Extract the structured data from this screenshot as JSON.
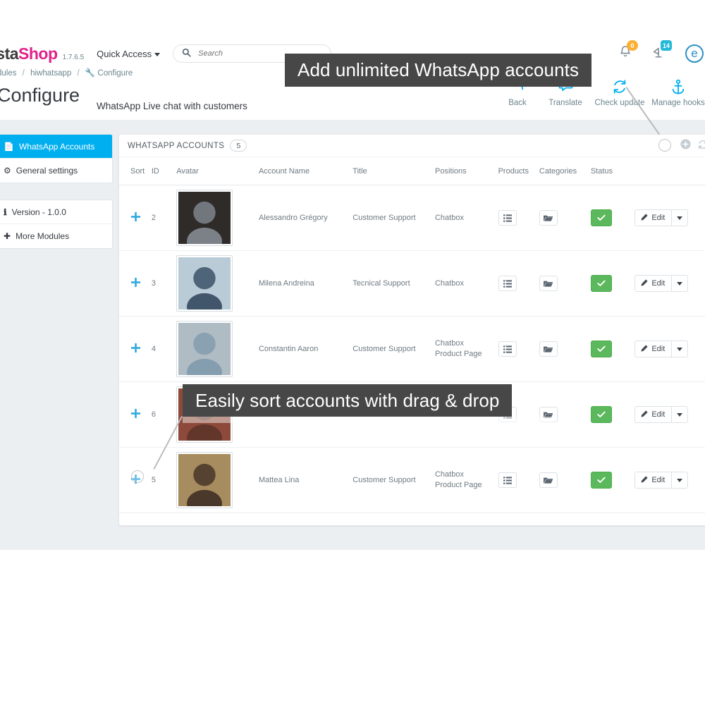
{
  "header": {
    "brand_part1": "estaShop",
    "brand_part2": "Shop",
    "brand_text_dark": "esta",
    "version": "1.7.6.5",
    "quick_access": "Quick Access",
    "search_placeholder": "Search",
    "search_value": "",
    "notifications_badge": "0",
    "orders_badge": "14",
    "icons": {
      "search": "search-icon",
      "bell": "bell-icon",
      "broadcast": "satellite-icon",
      "avatar": "user-avatar-icon"
    }
  },
  "breadcrumb": {
    "item1": "Modules",
    "item2": "hiwhatsapp",
    "item3": "Configure",
    "separator": "/"
  },
  "page": {
    "title": "Configure",
    "subtitle": "WhatsApp Live chat with customers"
  },
  "toolbar": {
    "items": [
      {
        "label": "Back",
        "icon": "back-arrow-icon"
      },
      {
        "label": "Translate",
        "icon": "translate-icon"
      },
      {
        "label": "Check update",
        "icon": "refresh-icon"
      },
      {
        "label": "Manage hooks",
        "icon": "anchor-icon"
      }
    ]
  },
  "sidebar": {
    "nav": [
      {
        "label": "WhatsApp Accounts",
        "icon": "whatsapp-accounts-icon",
        "active": true
      },
      {
        "label": "General settings",
        "icon": "gear-icon",
        "active": false
      }
    ],
    "info": [
      {
        "label": "Version - 1.0.0",
        "icon": "info-icon"
      },
      {
        "label": "More Modules",
        "icon": "plus-box-icon"
      }
    ]
  },
  "panel": {
    "title": "WHATSAPP ACCOUNTS",
    "count": "5",
    "actions": [
      {
        "name": "add-account-button",
        "icon": "plus-circle-icon"
      },
      {
        "name": "refresh-list-button",
        "icon": "refresh-icon"
      }
    ]
  },
  "table": {
    "columns": [
      "Sort",
      "ID",
      "Avatar",
      "Account Name",
      "Title",
      "Positions",
      "Products",
      "Categories",
      "Status",
      ""
    ],
    "rows": [
      {
        "id": "2",
        "name": "Alessandro Grégory",
        "title": "Customer Support",
        "positions": [
          "Chatbox"
        ],
        "status": "enabled",
        "edit_label": "Edit",
        "avatar_tone": "#2e2b28",
        "avatar_tone2": "#8a9099"
      },
      {
        "id": "3",
        "name": "Milena Andreina",
        "title": "Tecnical Support",
        "positions": [
          "Chatbox"
        ],
        "status": "enabled",
        "edit_label": "Edit",
        "avatar_tone": "#b9cbd6",
        "avatar_tone2": "#2b4258"
      },
      {
        "id": "4",
        "name": "Constantin Aaron",
        "title": "Customer Support",
        "positions": [
          "Chatbox",
          "Product Page"
        ],
        "status": "enabled",
        "edit_label": "Edit",
        "avatar_tone": "#b0bcc4",
        "avatar_tone2": "#7d98ab"
      },
      {
        "id": "6",
        "name": "",
        "title": "",
        "positions": [],
        "status": "enabled",
        "edit_label": "Edit",
        "avatar_tone": "#8d4a3a",
        "avatar_tone2": "#5a3328"
      },
      {
        "id": "5",
        "name": "Mattea Lina",
        "title": "Customer Support",
        "positions": [
          "Chatbox",
          "Product Page"
        ],
        "status": "enabled",
        "edit_label": "Edit",
        "avatar_tone": "#a78c5f",
        "avatar_tone2": "#3a2a22"
      }
    ]
  },
  "callouts": [
    {
      "text": "Add unlimited WhatsApp accounts"
    },
    {
      "text": "Easily sort accounts with drag & drop"
    }
  ],
  "colors": {
    "accent_blue": "#00aff0",
    "brand_pink": "#e0218a",
    "status_green": "#5cb85c",
    "callout_bg": "#474747",
    "page_bg": "#eceff1"
  }
}
